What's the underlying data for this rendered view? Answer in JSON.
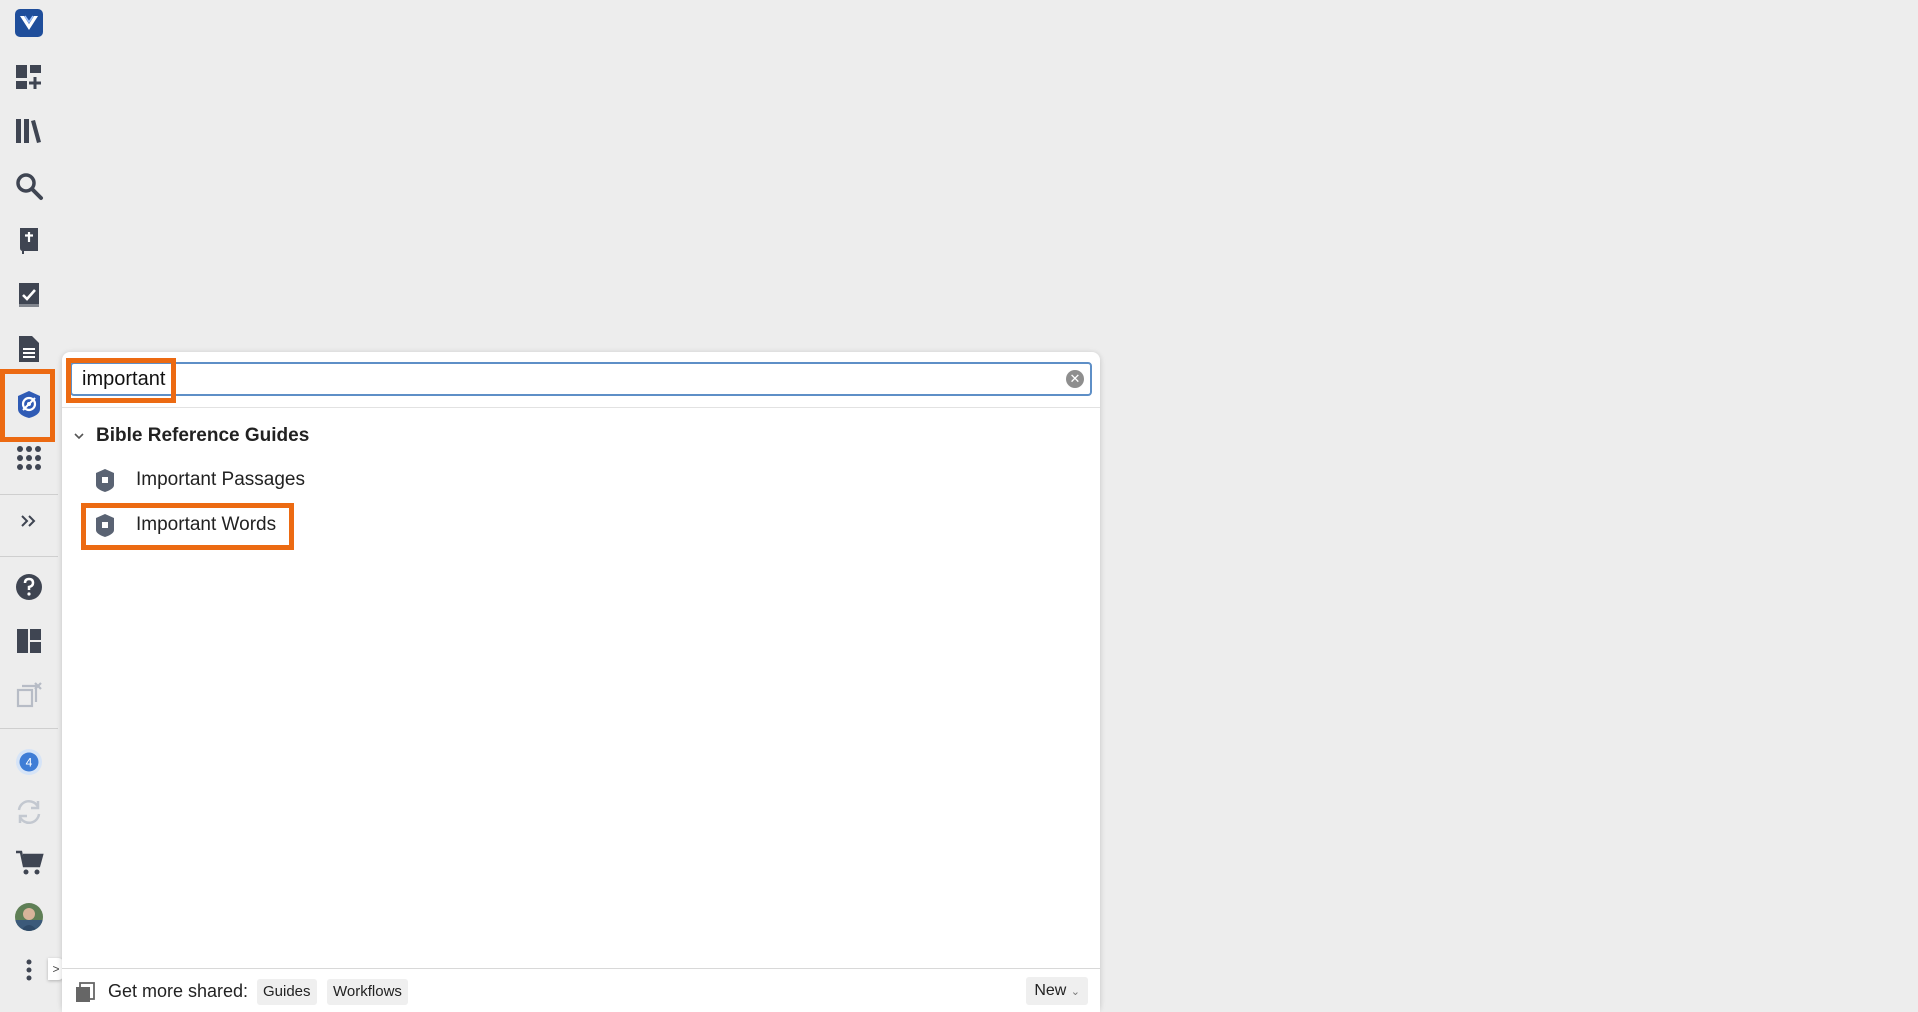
{
  "sidebar": {
    "items": [
      {
        "name": "logo-icon"
      },
      {
        "name": "add-layout-icon"
      },
      {
        "name": "library-icon"
      },
      {
        "name": "search-icon"
      },
      {
        "name": "bible-icon"
      },
      {
        "name": "checklist-icon"
      },
      {
        "name": "document-icon"
      },
      {
        "name": "guides-icon"
      },
      {
        "name": "tools-grid-icon"
      },
      {
        "name": "expand-icon"
      },
      {
        "name": "help-icon"
      },
      {
        "name": "layouts-icon"
      },
      {
        "name": "close-panels-icon"
      },
      {
        "name": "notifications-icon"
      },
      {
        "name": "sync-icon"
      },
      {
        "name": "cart-icon"
      },
      {
        "name": "avatar"
      },
      {
        "name": "more-icon"
      }
    ],
    "notification_count": "4"
  },
  "search": {
    "value": "important"
  },
  "results": {
    "group_title": "Bible Reference Guides",
    "items": [
      {
        "label": "Important Passages"
      },
      {
        "label": "Important Words"
      }
    ]
  },
  "footer": {
    "label": "Get more shared:",
    "chip1": "Guides",
    "chip2": "Workflows",
    "new_label": "New"
  },
  "colors": {
    "highlight": "#ec6a12",
    "accent": "#2f5bb5",
    "icon": "#3f4552"
  }
}
